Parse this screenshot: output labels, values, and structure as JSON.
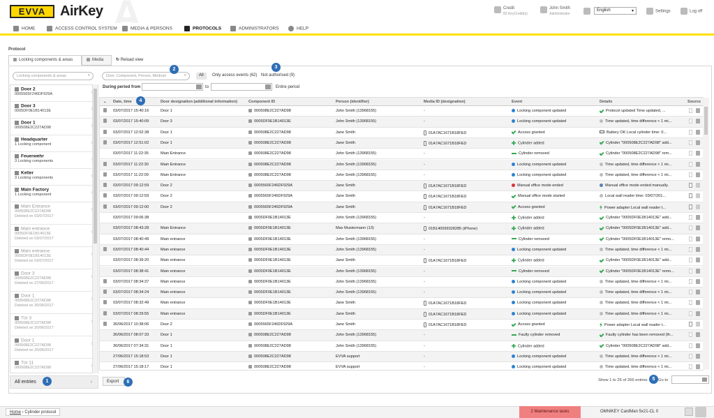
{
  "header": {
    "logo": "EVVA",
    "app_name": "AirKey",
    "credit_label": "Credit",
    "credit_sub": "83 KeyCredit(s)",
    "user_name": "John Smith",
    "user_role": "Administrator",
    "language": "English",
    "settings": "Settings",
    "logoff": "Log off"
  },
  "nav": [
    "HOME",
    "ACCESS CONTROL SYSTEM",
    "MEDIA & PERSONS",
    "PROTOCOLS",
    "ADMINISTRATORS",
    "HELP"
  ],
  "page": {
    "section_label": "Protocol",
    "tab_locking": "Locking components & areas",
    "tab_media": "Media",
    "reload": "Reload view"
  },
  "left_panel": {
    "search_placeholder": "Locking components & areas",
    "items": [
      {
        "title": "Door 2",
        "sub": "0005565F246DF929A",
        "deleted": false
      },
      {
        "title": "Door 3",
        "sub": "0005DF0E1B14013E",
        "deleted": false
      },
      {
        "title": "Door 1",
        "sub": "000508E2C227AD98",
        "deleted": false
      },
      {
        "title": "Headquarter",
        "sub": "1 Locking component",
        "deleted": false
      },
      {
        "title": "Feuerwehr",
        "sub": "3 Locking components",
        "deleted": false
      },
      {
        "title": "Keller",
        "sub": "3 Locking components",
        "deleted": false
      },
      {
        "title": "Main Factory",
        "sub": "1 Locking component",
        "deleted": false
      },
      {
        "title": "Main Entrance",
        "sub": "000508E2C227AD98",
        "sub2": "Deleted on 03/07/2017",
        "deleted": true
      },
      {
        "title": "Main entrance",
        "sub": "0005DF0E1B14013E",
        "sub2": "Deleted on 03/07/2017",
        "deleted": true
      },
      {
        "title": "Main entrance",
        "sub": "0005DF0E1B14013E",
        "sub2": "Deleted on 03/07/2017",
        "deleted": true
      },
      {
        "title": "Door 3",
        "sub": "000508E2C227AD98",
        "sub2": "Deleted on 27/06/2017",
        "deleted": true
      },
      {
        "title": "Door 1",
        "sub": "000508E2C227AD98",
        "sub2": "Deleted on 30/06/2017",
        "deleted": true
      },
      {
        "title": "Tür 3",
        "sub": "000508E2C227AD98",
        "sub2": "Deleted on 20/06/2017",
        "deleted": true
      },
      {
        "title": "Door 1",
        "sub": "000508E2C227AD98",
        "sub2": "Deleted on 20/06/2017",
        "deleted": true
      },
      {
        "title": "Tür 11",
        "sub": "000508E2C227AD98",
        "sub2": "",
        "deleted": true
      }
    ],
    "all_entries": "All entries"
  },
  "filters": {
    "search_placeholder": "Door, Component, Person, Medium",
    "all": "All",
    "only_access": "Only access events (62)",
    "not_authorised": "Not authorised (9)",
    "period_label": "During period from",
    "to": "to",
    "entire_period": "Entire period"
  },
  "table": {
    "columns": [
      "Date, time",
      "Door designation (additional information)",
      "Component ID",
      "Person (identifier)",
      "Media ID (designation)",
      "Event",
      "Details",
      "Source"
    ],
    "rows": [
      {
        "dt": "03/07/2017 15:40:16",
        "door": "Door 1",
        "comp": "000508E2C227AD98",
        "person": "John Smith (13968155)",
        "media": "-",
        "event": "Locking component updated",
        "eic": "blue",
        "details": "Protocol updated Time updated, ...",
        "dic": "green",
        "trash": true,
        "mic": false,
        "src": "lock"
      },
      {
        "dt": "03/07/2017 15:40:09",
        "door": "Door 3",
        "comp": "0005DF0E1B14013E",
        "person": "John Smith (13968155)",
        "media": "-",
        "event": "Locking component updated",
        "eic": "blue",
        "details": "Time updated, time difference < 1 mi...",
        "dic": "grey",
        "trash": true,
        "mic": false,
        "src": "lock"
      },
      {
        "dt": "03/07/2017 12:52:38",
        "door": "Door 1",
        "comp": "000508E2C227AD98",
        "person": "Jane Smith",
        "media": "01A7AC1671B18FED",
        "event": "Access granted",
        "eic": "green",
        "details": "Battery OK Local cylinder time: 0...",
        "dic": "batt",
        "trash": true,
        "mic": true,
        "src": "lock"
      },
      {
        "dt": "03/07/2017 12:51:02",
        "door": "Door 1",
        "comp": "000508E2C227AD98",
        "person": "Jane Smith",
        "media": "01A7AC1671B18FED",
        "event": "Cylinder added",
        "eic": "plus",
        "details": "Cylinder \"000508E2C227AD98\" add...",
        "dic": "green",
        "trash": true,
        "mic": true,
        "src": "lock"
      },
      {
        "dt": "03/07/2017 11:22:35",
        "door": "Main Entrance",
        "comp": "000508E2C227AD98",
        "person": "John Smith (13968155)",
        "media": "-",
        "event": "Cylinder removed",
        "eic": "minus",
        "details": "Cylinder \"000508E2C227AD98\" rem...",
        "dic": "green",
        "trash": false,
        "mic": false,
        "src": "lock"
      },
      {
        "dt": "03/07/2017 11:22:30",
        "door": "Main Entrance",
        "comp": "000508E2C227AD98",
        "person": "John Smith (13968155)",
        "media": "-",
        "event": "Locking component updated",
        "eic": "blue",
        "details": "Time updated, time difference < 1 mi...",
        "dic": "grey",
        "trash": true,
        "mic": false,
        "src": "lock"
      },
      {
        "dt": "03/07/2017 11:22:09",
        "door": "Main Entrance",
        "comp": "000508E2C227AD98",
        "person": "John Smith (13968155)",
        "media": "-",
        "event": "Locking component updated",
        "eic": "blue",
        "details": "Time updated, time difference < 1 mi...",
        "dic": "grey",
        "trash": true,
        "mic": false,
        "src": "lock"
      },
      {
        "dt": "03/07/2017 09:12:59",
        "door": "Door 2",
        "comp": "0005565F246DF929A",
        "person": "Jane Smith",
        "media": "01A7AC1671B18FED",
        "event": "Manual office mode ended",
        "eic": "red",
        "details": "Manual office mode ended manually.",
        "dic": "person",
        "trash": true,
        "mic": true,
        "src": "phone"
      },
      {
        "dt": "03/07/2017 09:12:59",
        "door": "Door 2",
        "comp": "0005565F246DF929A",
        "person": "Jane Smith",
        "media": "01A7AC1671B18FED",
        "event": "Manual office mode started",
        "eic": "green",
        "details": "Local wall reader time: 03/07/201...",
        "dic": "grey",
        "trash": true,
        "mic": true,
        "src": "phone"
      },
      {
        "dt": "03/07/2017 09:12:00",
        "door": "Door 2",
        "comp": "0005565F246DF929A",
        "person": "Jane Smith",
        "media": "01A7AC1671B18FED",
        "event": "Access granted",
        "eic": "green",
        "details": "Power adapter Local wall reader t...",
        "dic": "pow",
        "trash": true,
        "mic": true,
        "src": "phone"
      },
      {
        "dt": "03/07/2017 09:06:38",
        "door": "",
        "comp": "0005DF0E1B14013E",
        "person": "John Smith (13968155)",
        "media": "-",
        "event": "Cylinder added",
        "eic": "plus",
        "details": "Cylinder \"0005DF0E1B14013E\" add...",
        "dic": "green",
        "trash": false,
        "mic": false,
        "src": "lock"
      },
      {
        "dt": "03/07/2017 08:43:28",
        "door": "Main Entrance",
        "comp": "0005DF0E1B14013E",
        "person": "Max Mustermann (13)",
        "media": "01B140099328285 (iPhone)",
        "event": "Cylinder added",
        "eic": "plus",
        "details": "Cylinder \"0005DF0E1B14013E\" add...",
        "dic": "green",
        "trash": false,
        "mic": true,
        "src": "lock"
      },
      {
        "dt": "03/07/2017 08:40:49",
        "door": "Main entrance",
        "comp": "0005DF0E1B14013E",
        "person": "John Smith (13968155)",
        "media": "-",
        "event": "Cylinder removed",
        "eic": "minus",
        "details": "Cylinder \"0005DF0E1B14013E\" remo...",
        "dic": "green",
        "trash": false,
        "mic": false,
        "src": "lock"
      },
      {
        "dt": "03/07/2017 08:40:44",
        "door": "Main entrance",
        "comp": "0005DF0E1B14013E",
        "person": "John Smith (13968155)",
        "media": "-",
        "event": "Locking component updated",
        "eic": "blue",
        "details": "Time updated, time difference < 1 mi...",
        "dic": "grey",
        "trash": true,
        "mic": false,
        "src": "lock"
      },
      {
        "dt": "03/07/2017 08:39:20",
        "door": "Main entrance",
        "comp": "0005DF0E1B14013E",
        "person": "Jane Smith",
        "media": "01A7AC1671B18FED",
        "event": "Cylinder added",
        "eic": "plus",
        "details": "Cylinder \"0005DF0E1B14013E\" add...",
        "dic": "green",
        "trash": false,
        "mic": true,
        "src": "lock"
      },
      {
        "dt": "03/07/2017 08:38:41",
        "door": "Main entrance",
        "comp": "0005DF0E1B14013E",
        "person": "John Smith (13968155)",
        "media": "-",
        "event": "Cylinder removed",
        "eic": "minus",
        "details": "Cylinder \"0005DF0E1B14013E\" remo...",
        "dic": "green",
        "trash": false,
        "mic": false,
        "src": "lock"
      },
      {
        "dt": "03/07/2017 08:34:37",
        "door": "Main entrance",
        "comp": "0005DF0E1B14013E",
        "person": "John Smith (13968155)",
        "media": "-",
        "event": "Locking component updated",
        "eic": "blue",
        "details": "Time updated, time difference < 1 mi...",
        "dic": "grey",
        "trash": true,
        "mic": false,
        "src": "lock"
      },
      {
        "dt": "03/07/2017 08:34:24",
        "door": "Main entrance",
        "comp": "0005DF0E1B14013E",
        "person": "John Smith (13968155)",
        "media": "-",
        "event": "Locking component updated",
        "eic": "blue",
        "details": "Time updated, time difference < 1 mi...",
        "dic": "grey",
        "trash": true,
        "mic": false,
        "src": "lock"
      },
      {
        "dt": "03/07/2017 08:32:49",
        "door": "Main entrance",
        "comp": "0005DF0E1B14013E",
        "person": "Jane Smith",
        "media": "01A7AC1671B18FED",
        "event": "Locking component updated",
        "eic": "blue",
        "details": "Time updated, time difference < 1 mi...",
        "dic": "grey",
        "trash": true,
        "mic": true,
        "src": "lock"
      },
      {
        "dt": "03/07/2017 08:29:55",
        "door": "Main entrance",
        "comp": "0005DF0E1B14013E",
        "person": "Jane Smith",
        "media": "01A7AC1671B18FED",
        "event": "Locking component updated",
        "eic": "blue",
        "details": "Time updated, time difference < 1 mi...",
        "dic": "grey",
        "trash": true,
        "mic": true,
        "src": "lock"
      },
      {
        "dt": "30/06/2017 10:38:06",
        "door": "Door 2",
        "comp": "0005565F246DF929A",
        "person": "Jane Smith",
        "media": "01A7AC1671B18FED",
        "event": "Access granted",
        "eic": "green",
        "details": "Power adapter Local wall reader t...",
        "dic": "pow",
        "trash": true,
        "mic": true,
        "src": "phone"
      },
      {
        "dt": "30/06/2017 08:07:33",
        "door": "Door 1",
        "comp": "000508E2C227AD98",
        "person": "John Smith (13968155)",
        "media": "-",
        "event": "Faulty cylinder removed",
        "eic": "minus",
        "details": "Faulty cylinder has been removed (th...",
        "dic": "green",
        "trash": false,
        "mic": false,
        "src": "lock"
      },
      {
        "dt": "30/06/2017 07:34:31",
        "door": "Door 1",
        "comp": "000508E2C227AD98",
        "person": "John Smith (13968155)",
        "media": "-",
        "event": "Cylinder added",
        "eic": "plus",
        "details": "Cylinder \"000508E2C227AD98\" add...",
        "dic": "green",
        "trash": false,
        "mic": false,
        "src": "lock"
      },
      {
        "dt": "27/06/2017 15:18:53",
        "door": "Door 1",
        "comp": "000508E2C227AD98",
        "person": "EVVA support",
        "media": "-",
        "event": "Locking component updated",
        "eic": "blue",
        "details": "Time updated, time difference < 1 mi...",
        "dic": "grey",
        "trash": false,
        "mic": false,
        "src": "lock"
      },
      {
        "dt": "27/06/2017 15:18:17",
        "door": "Door 1",
        "comp": "000508E2C227AD98",
        "person": "EVVA support",
        "media": "-",
        "event": "Locking component updated",
        "eic": "blue",
        "details": "Time updated, time difference < 1 mi...",
        "dic": "grey",
        "trash": false,
        "mic": false,
        "src": "lock"
      }
    ]
  },
  "footer": {
    "export": "Export",
    "showing": "Show 1 to 26 of 266 entries",
    "goto": "Go to"
  },
  "badges": [
    "1",
    "2",
    "3",
    "4",
    "5",
    "6"
  ],
  "status": {
    "breadcrumb_home": "Home",
    "breadcrumb_sep": " › ",
    "breadcrumb_page": "Cylinder protocol",
    "maintenance": "2 Maintenance tasks",
    "reader": "OMNIKEY CardMan 5x21-CL 0"
  },
  "colors": {
    "accent_yellow": "#ffe000",
    "badge_blue": "#2e6eb5",
    "maintenance_red": "#f08080"
  }
}
